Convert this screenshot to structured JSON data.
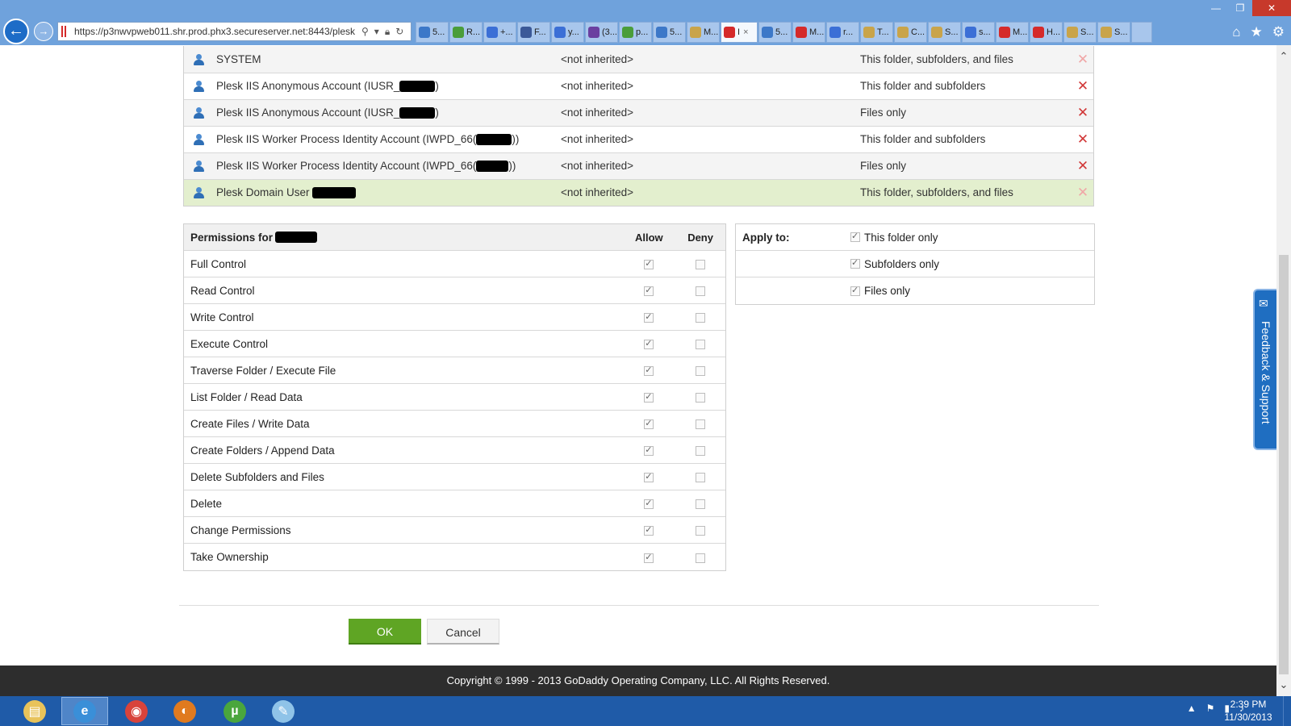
{
  "browser": {
    "url": "https://p3nwvpweb011.shr.prod.phx3.secureserver.net:8443/plesk",
    "tabs": [
      {
        "label": "5...",
        "color": "#3c78c8",
        "active": false
      },
      {
        "label": "R...",
        "color": "#4a9d3a",
        "active": false
      },
      {
        "label": "+...",
        "color": "#3b6fd6",
        "active": false
      },
      {
        "label": "F...",
        "color": "#3b5998",
        "active": false
      },
      {
        "label": "y...",
        "color": "#3b6fd6",
        "active": false
      },
      {
        "label": "(3...",
        "color": "#6b3fa0",
        "active": false
      },
      {
        "label": "p...",
        "color": "#4a9d3a",
        "active": false
      },
      {
        "label": "5...",
        "color": "#3c78c8",
        "active": false
      },
      {
        "label": "M...",
        "color": "#c9a44a",
        "active": false
      },
      {
        "label": "I",
        "color": "#d52a2a",
        "active": true
      },
      {
        "label": "5...",
        "color": "#3c78c8",
        "active": false
      },
      {
        "label": "M...",
        "color": "#d52a2a",
        "active": false
      },
      {
        "label": "r...",
        "color": "#3b6fd6",
        "active": false
      },
      {
        "label": "T...",
        "color": "#c9a44a",
        "active": false
      },
      {
        "label": "C...",
        "color": "#c9a44a",
        "active": false
      },
      {
        "label": "S...",
        "color": "#c9a44a",
        "active": false
      },
      {
        "label": "s...",
        "color": "#3b6fd6",
        "active": false
      },
      {
        "label": "M...",
        "color": "#d52a2a",
        "active": false
      },
      {
        "label": "H...",
        "color": "#d52a2a",
        "active": false
      },
      {
        "label": "S...",
        "color": "#c9a44a",
        "active": false
      },
      {
        "label": "S...",
        "color": "#c9a44a",
        "active": false
      }
    ]
  },
  "acl_entries": [
    {
      "name": "SYSTEM",
      "redact_width": 0,
      "suffix": "",
      "inherited": "<not inherited>",
      "apply_to": "This folder, subfolders, and files",
      "delete_enabled": false,
      "selected": false
    },
    {
      "name": "Plesk IIS Anonymous Account (IUSR_",
      "redact_width": 44,
      "suffix": ")",
      "inherited": "<not inherited>",
      "apply_to": "This folder and subfolders",
      "delete_enabled": true,
      "selected": false
    },
    {
      "name": "Plesk IIS Anonymous Account (IUSR_",
      "redact_width": 44,
      "suffix": ")",
      "inherited": "<not inherited>",
      "apply_to": "Files only",
      "delete_enabled": true,
      "selected": false
    },
    {
      "name": "Plesk IIS Worker Process Identity Account (IWPD_66(",
      "redact_width": 44,
      "suffix": "))",
      "inherited": "<not inherited>",
      "apply_to": "This folder and subfolders",
      "delete_enabled": true,
      "selected": false
    },
    {
      "name": "Plesk IIS Worker Process Identity Account (IWPD_66(",
      "redact_width": 40,
      "suffix": "))",
      "inherited": "<not inherited>",
      "apply_to": "Files only",
      "delete_enabled": true,
      "selected": false
    },
    {
      "name": "Plesk Domain User ",
      "redact_width": 54,
      "suffix": "",
      "inherited": "<not inherited>",
      "apply_to": "This folder, subfolders, and files",
      "delete_enabled": false,
      "selected": true
    }
  ],
  "permissions": {
    "title": "Permissions for",
    "allow_label": "Allow",
    "deny_label": "Deny",
    "items": [
      {
        "name": "Full Control",
        "allow": true,
        "deny": false
      },
      {
        "name": "Read Control",
        "allow": true,
        "deny": false
      },
      {
        "name": "Write Control",
        "allow": true,
        "deny": false
      },
      {
        "name": "Execute Control",
        "allow": true,
        "deny": false
      },
      {
        "name": "Traverse Folder / Execute File",
        "allow": true,
        "deny": false
      },
      {
        "name": "List Folder / Read Data",
        "allow": true,
        "deny": false
      },
      {
        "name": "Create Files / Write Data",
        "allow": true,
        "deny": false
      },
      {
        "name": "Create Folders / Append Data",
        "allow": true,
        "deny": false
      },
      {
        "name": "Delete Subfolders and Files",
        "allow": true,
        "deny": false
      },
      {
        "name": "Delete",
        "allow": true,
        "deny": false
      },
      {
        "name": "Change Permissions",
        "allow": true,
        "deny": false
      },
      {
        "name": "Take Ownership",
        "allow": true,
        "deny": false
      }
    ]
  },
  "apply_to": {
    "label": "Apply to:",
    "options": [
      {
        "label": "This folder only",
        "checked": true
      },
      {
        "label": "Subfolders only",
        "checked": true
      },
      {
        "label": "Files only",
        "checked": true
      }
    ]
  },
  "buttons": {
    "ok": "OK",
    "cancel": "Cancel"
  },
  "footer": {
    "copyright": "Copyright © 1999 - 2013 GoDaddy Operating Company, LLC. All Rights Reserved."
  },
  "feedback": {
    "label": "Feedback & Support"
  },
  "taskbar": {
    "apps": [
      {
        "name": "file-explorer",
        "color": "#e8c35a",
        "glyph": "▤"
      },
      {
        "name": "internet-explorer",
        "color": "#3a8fd8",
        "glyph": "e"
      },
      {
        "name": "chrome",
        "color": "#d8433b",
        "glyph": "◉"
      },
      {
        "name": "firefox",
        "color": "#e07a1f",
        "glyph": "◐"
      },
      {
        "name": "utorrent",
        "color": "#4aa63d",
        "glyph": "µ"
      },
      {
        "name": "notepad",
        "color": "#8fc3e8",
        "glyph": "✎"
      }
    ],
    "time": "2:39 PM",
    "date": "11/30/2013"
  },
  "colors": {
    "accent_ok": "#5fa524",
    "selected_row": "#e3efce",
    "footer_bg": "#2d2d2d",
    "taskbar_bg": "#1f5ba8"
  }
}
